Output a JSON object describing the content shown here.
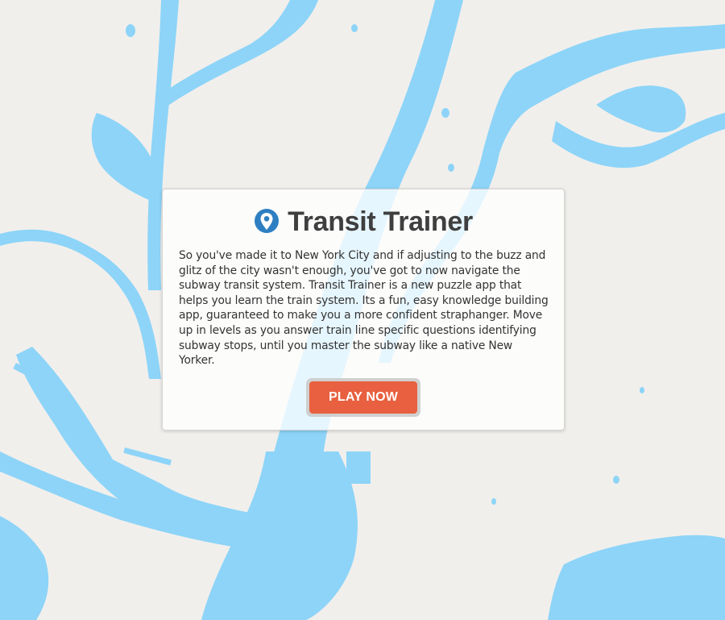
{
  "app": {
    "title": "Transit Trainer",
    "description": "So you've made it to New York City and if adjusting to the buzz and glitz of the city wasn't enough, you've got to now navigate the subway transit system. Transit Trainer is a new puzzle app that helps you learn the train system. Its a fun, easy knowledge building app, guaranteed to make you a more confident straphanger. Move up in levels as you answer train line specific questions identifying subway stops, until you master the subway like a native New Yorker.",
    "play_button_label": "PLAY NOW",
    "icon": "map-pin-icon"
  },
  "colors": {
    "land": "#f1efec",
    "water": "#8dd4f8",
    "accent": "#e8603f",
    "pin": "#2d7fc1",
    "title_text": "#3f3f3f"
  }
}
